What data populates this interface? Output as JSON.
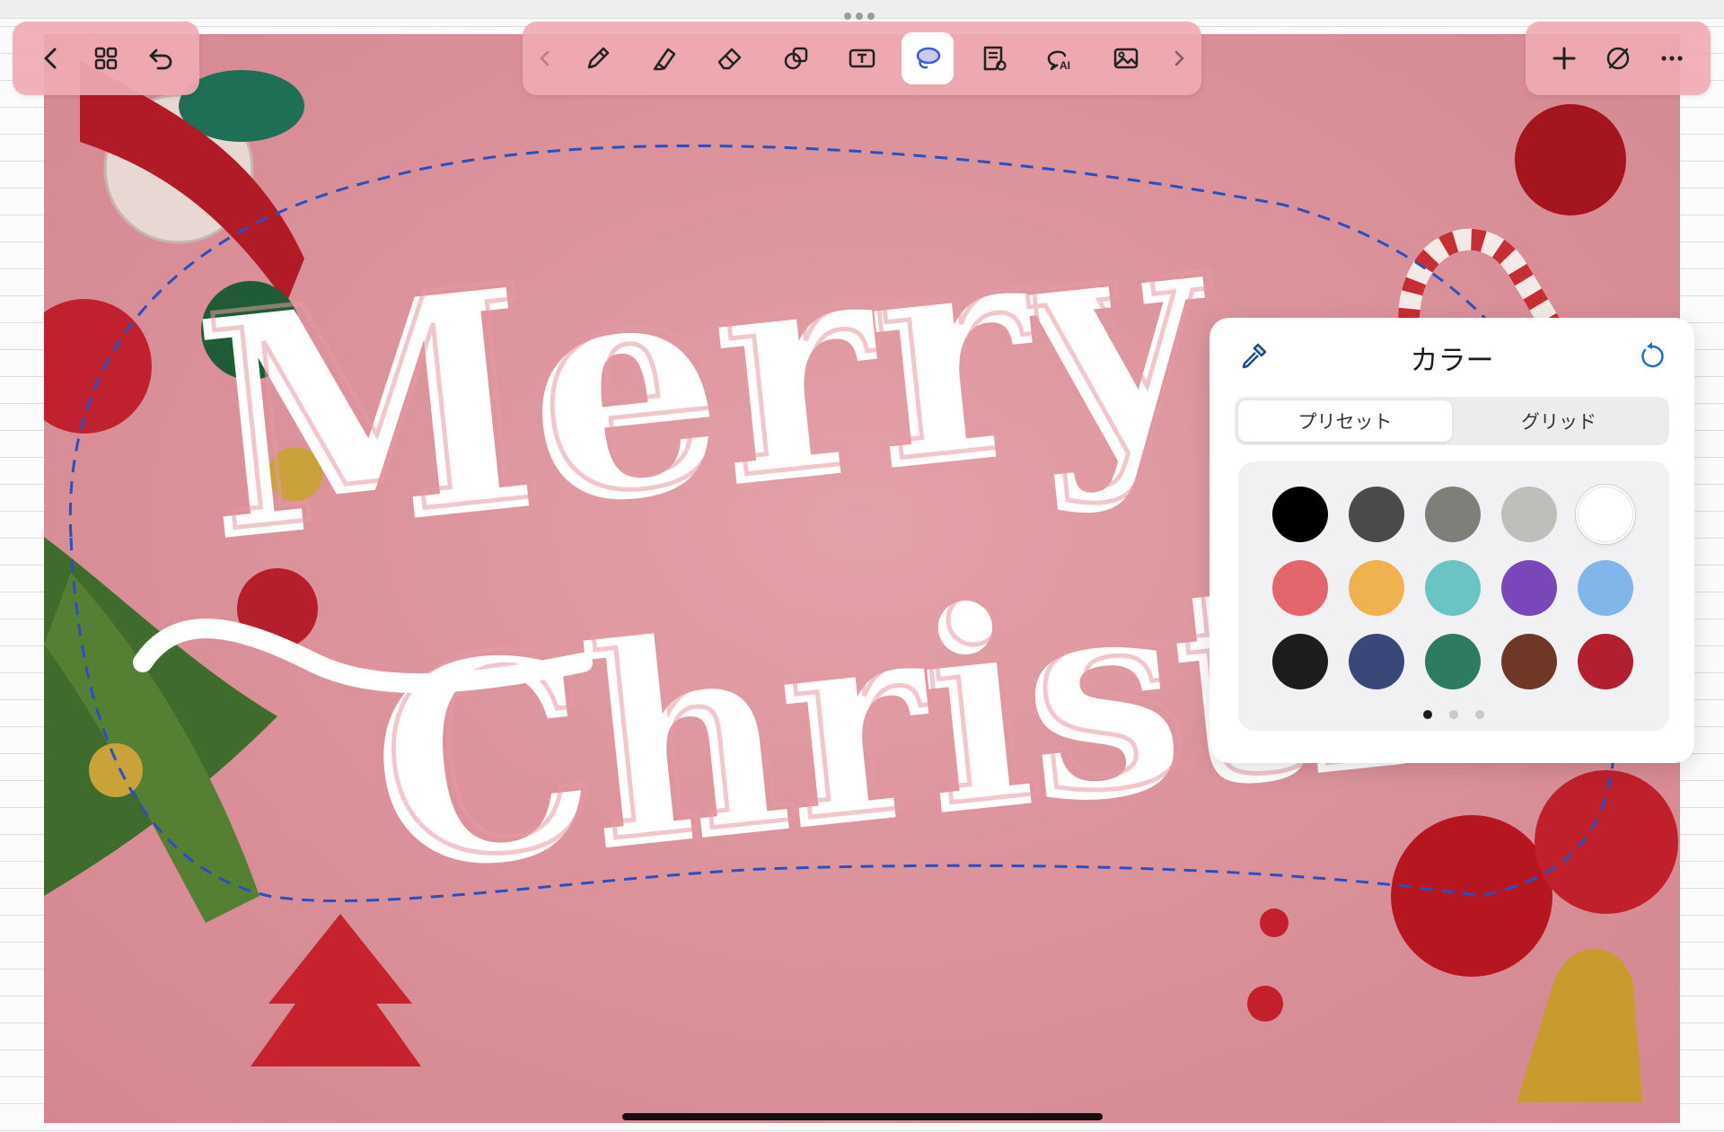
{
  "toolbar_left": {
    "icons": [
      "chevron-left-icon",
      "grid-icon",
      "undo-icon"
    ]
  },
  "toolbar_center": {
    "icons": [
      "chevron-left-icon",
      "pen-icon",
      "highlighter-icon",
      "eraser-icon",
      "shapes-icon",
      "text-box-icon",
      "lasso-icon",
      "sticky-note-icon",
      "ai-chat-icon",
      "image-icon",
      "chevron-right-icon"
    ],
    "active_tool": "lasso"
  },
  "toolbar_right": {
    "icons": [
      "plus-icon",
      "no-pen-icon",
      "more-icon"
    ]
  },
  "canvas": {
    "handwriting": "Merry Christmas",
    "background_color": "#dd959c",
    "lasso_color": "#2b4fc0"
  },
  "color_panel": {
    "title": "カラー",
    "tabs": [
      {
        "label": "プリセット",
        "selected": true
      },
      {
        "label": "グリッド",
        "selected": false
      }
    ],
    "swatches": [
      "#000000",
      "#4a4a48",
      "#7f7f7a",
      "#bebfbb",
      "#ffffff",
      "#e2666c",
      "#efb24f",
      "#6cc3c3",
      "#7a47b8",
      "#82b6ea",
      "#1e1c1f",
      "#394879",
      "#2e7a63",
      "#6f3826",
      "#b41f2f"
    ],
    "selected_swatch": "#ffffff",
    "page_dots": 3,
    "current_page": 1
  }
}
